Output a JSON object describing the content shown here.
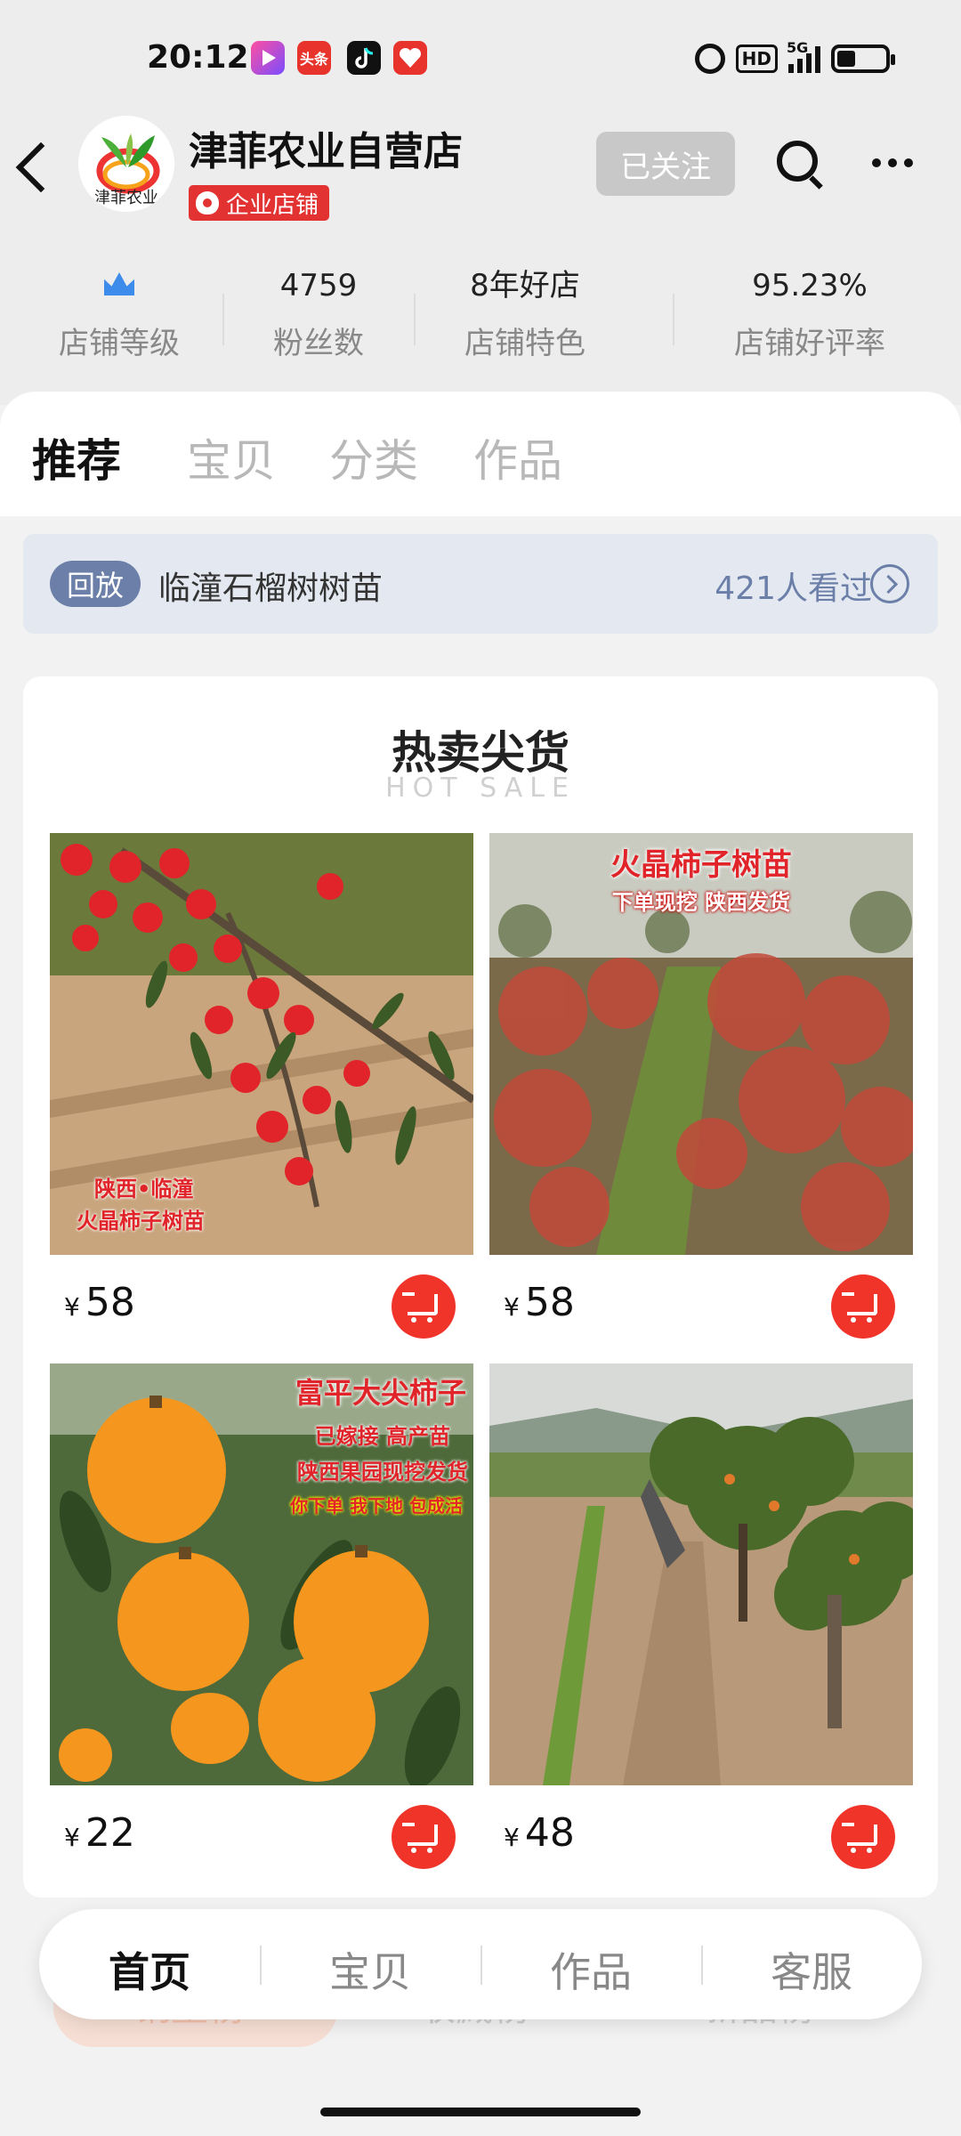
{
  "status_bar": {
    "time": "20:12",
    "app_icons": [
      "video-app-icon",
      "toutiao-app-icon",
      "douyin-app-icon",
      "heart-app-icon"
    ],
    "toutiao_label": "头条",
    "hd": "HD",
    "network": "5G",
    "battery_level": 0.3
  },
  "header": {
    "shop_name": "津菲农业自营店",
    "logo_text": "津菲农业",
    "badge": "企业店铺",
    "follow_label": "已关注"
  },
  "stats": [
    {
      "value": "",
      "label": "店铺等级"
    },
    {
      "value": "4759",
      "label": "粉丝数"
    },
    {
      "value": "8年好店",
      "label": "店铺特色"
    },
    {
      "value": "95.23%",
      "label": "店铺好评率"
    }
  ],
  "tabs": [
    "推荐",
    "宝贝",
    "分类",
    "作品"
  ],
  "replay": {
    "badge": "回放",
    "title": "临潼石榴树树苗",
    "views": "421人看过"
  },
  "section": {
    "title": "热卖尖货",
    "subtitle": "HOT SALE"
  },
  "products": [
    {
      "price": "58",
      "currency": "¥",
      "overlay": [
        "陕西•临潼",
        "火晶柿子树苗"
      ]
    },
    {
      "price": "58",
      "currency": "¥",
      "overlay": [
        "火晶柿子树苗",
        "下单现挖 陕西发货"
      ]
    },
    {
      "price": "22",
      "currency": "¥",
      "overlay": [
        "富平大尖柿子",
        "已嫁接 高产苗",
        "陕西果园现挖发货",
        "你下单 我下地 包成活"
      ]
    },
    {
      "price": "48",
      "currency": "¥",
      "overlay": []
    }
  ],
  "ghost_tabs": [
    "销量榜",
    "收藏榜",
    "新品榜"
  ],
  "bottom_nav": [
    "首页",
    "宝贝",
    "作品",
    "客服"
  ],
  "colors": {
    "accent_red": "#f0342a",
    "badge_red": "#e23232",
    "replay_blue": "#6b7fa8",
    "crown_blue": "#3d8bea"
  }
}
